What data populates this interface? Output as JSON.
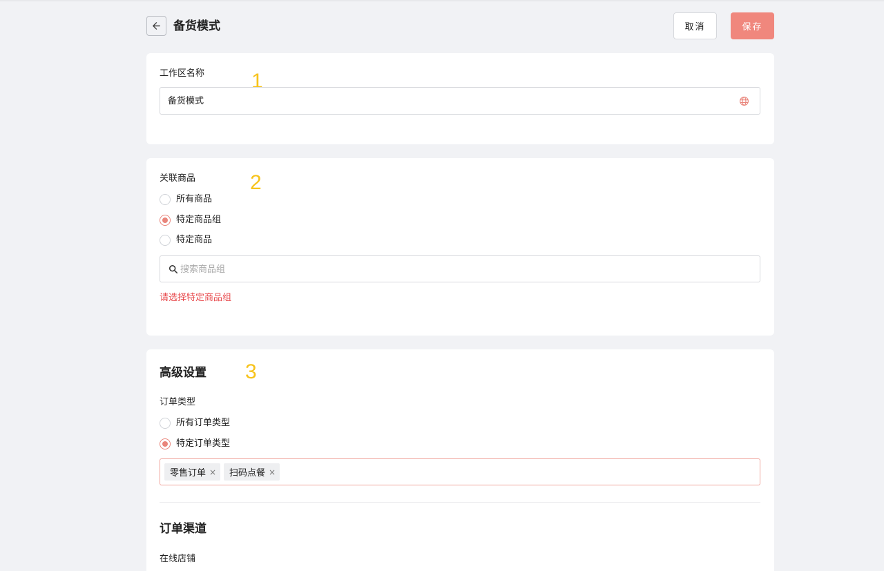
{
  "header": {
    "title": "备货模式",
    "cancel_label": "取消",
    "save_label": "保存"
  },
  "workspace": {
    "marker": "1",
    "label": "工作区名称",
    "value": "备货模式"
  },
  "products": {
    "marker": "2",
    "label": "关联商品",
    "options": [
      {
        "label": "所有商品",
        "checked": false
      },
      {
        "label": "特定商品组",
        "checked": true
      },
      {
        "label": "特定商品",
        "checked": false
      }
    ],
    "search_placeholder": "搜索商品组",
    "error": "请选择特定商品组"
  },
  "advanced": {
    "marker": "3",
    "title": "高级设置",
    "order_type_label": "订单类型",
    "order_type_options": [
      {
        "label": "所有订单类型",
        "checked": false
      },
      {
        "label": "特定订单类型",
        "checked": true
      }
    ],
    "tags": [
      "零售订单",
      "扫码点餐"
    ],
    "channel_title": "订单渠道",
    "online_store_label": "在线店铺"
  },
  "colors": {
    "accent": "#f0877d",
    "error": "#e8484b",
    "marker": "#f7c31b"
  }
}
